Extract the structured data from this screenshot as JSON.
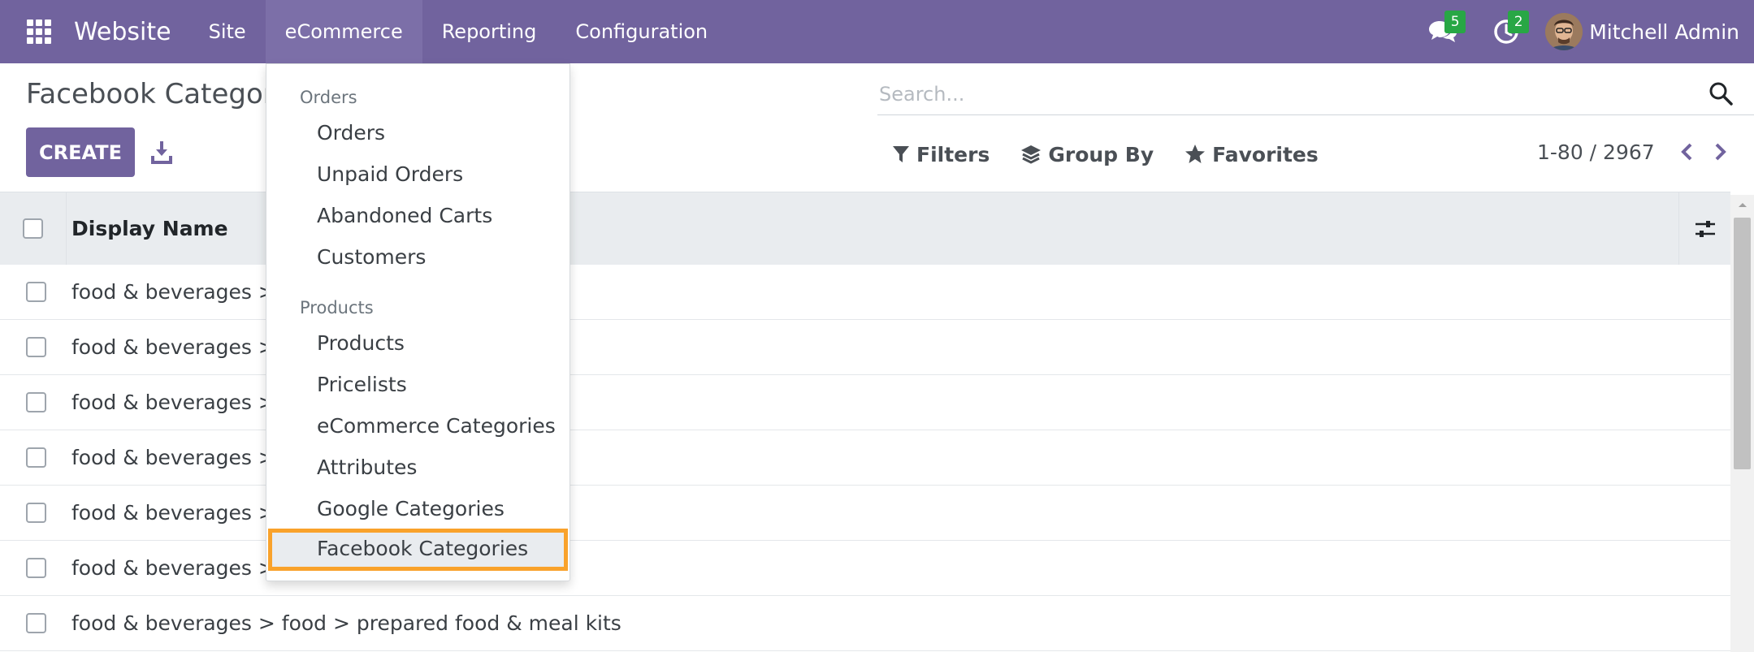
{
  "navbar": {
    "brand": "Website",
    "menus": [
      "Site",
      "eCommerce",
      "Reporting",
      "Configuration"
    ],
    "active_menu": "eCommerce",
    "messages_count": "5",
    "activities_count": "2",
    "user_name": "Mitchell Admin",
    "accent_color": "#71639e"
  },
  "control_panel": {
    "title": "Facebook Categor",
    "create_label": "CREATE",
    "search_placeholder": "Search...",
    "filters_label": "Filters",
    "group_by_label": "Group By",
    "favorites_label": "Favorites",
    "pager_text": "1-80 / 2967"
  },
  "list": {
    "column_header": "Display Name",
    "rows": [
      "food & beverages > fo",
      "food & beverages > fo",
      "food & beverages > fo",
      "food & beverages > fo",
      "food & beverages > fo",
      "food & beverages > fo",
      "food & beverages > food > prepared food & meal kits"
    ]
  },
  "dropdown": {
    "sections": [
      {
        "header": "Orders",
        "items": [
          "Orders",
          "Unpaid Orders",
          "Abandoned Carts",
          "Customers"
        ]
      },
      {
        "header": "Products",
        "items": [
          "Products",
          "Pricelists",
          "eCommerce Categories",
          "Attributes",
          "Google Categories",
          "Facebook Categories"
        ]
      }
    ],
    "highlighted_item": "Facebook Categories",
    "highlight_color": "#f9a22b"
  },
  "icons": {
    "apps": "apps-grid-icon",
    "messages": "chat-bubbles-icon",
    "activities": "clock-icon",
    "download": "download-icon",
    "search": "search-icon",
    "filters": "funnel-icon",
    "group_by": "layers-icon",
    "favorites": "star-icon",
    "pager_prev": "chevron-left-icon",
    "pager_next": "chevron-right-icon",
    "optional_columns": "sliders-icon"
  }
}
